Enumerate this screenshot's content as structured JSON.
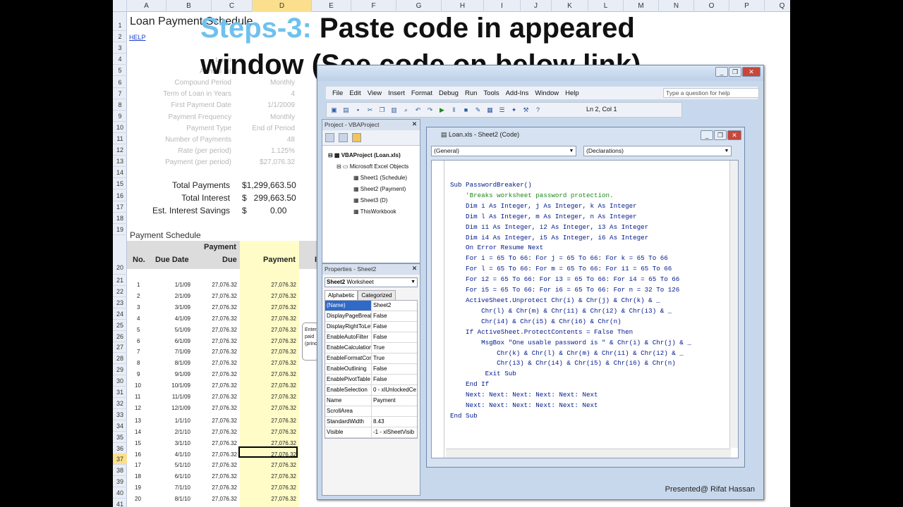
{
  "overlay": {
    "steps_label": "Steps-3:",
    "line1_rest": " Paste code in appeared",
    "line2": "window (See code on below link)."
  },
  "excel": {
    "columns": [
      "A",
      "B",
      "C",
      "D",
      "E",
      "F",
      "G",
      "H",
      "I",
      "J",
      "K",
      "L",
      "M",
      "N",
      "O",
      "P",
      "Q"
    ],
    "title": "Loan Payment Schedule",
    "help_link": "HELP",
    "ghost_labels": [
      "Loan",
      "Annual Int",
      "Compound Period",
      "Term of Loan in Years",
      "First Payment Date",
      "Payment Frequency",
      "Payment Type",
      "Number of Payments",
      "Rate (per period)",
      "Payment (per period)"
    ],
    "ghost_values": [
      "",
      "",
      "Monthly",
      "4",
      "1/1/2009",
      "Monthly",
      "End of Period",
      "48",
      "1.125%",
      "$27,076.32"
    ],
    "totals": [
      {
        "label": "Total Payments",
        "value": "$1,299,663.50"
      },
      {
        "label": "Total Interest",
        "value": "$   299,663.50"
      },
      {
        "label": "Est. Interest Savings",
        "value": "$          0.00"
      }
    ],
    "schedule_title": "Payment Schedule",
    "headers": {
      "payment_top": "Payment",
      "no": "No.",
      "due_date": "Due Date",
      "due": "Due",
      "payment": "Payment",
      "interest": "In"
    },
    "row_numbers": [
      "1",
      "2",
      "3",
      "4",
      "5",
      "6",
      "7",
      "8",
      "9",
      "10",
      "11",
      "12",
      "13",
      "14",
      "15",
      "16",
      "17",
      "18",
      "19",
      "20",
      "21",
      "22",
      "23",
      "24",
      "25",
      "26",
      "27",
      "28",
      "29",
      "30",
      "31",
      "32",
      "33",
      "34",
      "35",
      "36",
      "37",
      "38",
      "39",
      "40",
      "41"
    ],
    "rows": [
      {
        "no": "1",
        "date": "1/1/09",
        "due": "27,076.32",
        "pay": "27,076.32"
      },
      {
        "no": "2",
        "date": "2/1/09",
        "due": "27,076.32",
        "pay": "27,076.32"
      },
      {
        "no": "3",
        "date": "3/1/09",
        "due": "27,076.32",
        "pay": "27,076.32"
      },
      {
        "no": "4",
        "date": "4/1/09",
        "due": "27,076.32",
        "pay": "27,076.32"
      },
      {
        "no": "5",
        "date": "5/1/09",
        "due": "27,076.32",
        "pay": "27,076.32"
      },
      {
        "no": "6",
        "date": "6/1/09",
        "due": "27,076.32",
        "pay": "27,076.32"
      },
      {
        "no": "7",
        "date": "7/1/09",
        "due": "27,076.32",
        "pay": "27,076.32"
      },
      {
        "no": "8",
        "date": "8/1/09",
        "due": "27,076.32",
        "pay": "27,076.32"
      },
      {
        "no": "9",
        "date": "9/1/09",
        "due": "27,076.32",
        "pay": "27,076.32"
      },
      {
        "no": "10",
        "date": "10/1/09",
        "due": "27,076.32",
        "pay": "27,076.32"
      },
      {
        "no": "11",
        "date": "11/1/09",
        "due": "27,076.32",
        "pay": "27,076.32"
      },
      {
        "no": "12",
        "date": "12/1/09",
        "due": "27,076.32",
        "pay": "27,076.32"
      },
      {
        "no": "13",
        "date": "1/1/10",
        "due": "27,076.32",
        "pay": "27,076.32"
      },
      {
        "no": "14",
        "date": "2/1/10",
        "due": "27,076.32",
        "pay": "27,076.32"
      },
      {
        "no": "15",
        "date": "3/1/10",
        "due": "27,076.32",
        "pay": "27,076.32"
      },
      {
        "no": "16",
        "date": "4/1/10",
        "due": "27,076.32",
        "pay": "27,076.32"
      },
      {
        "no": "17",
        "date": "5/1/10",
        "due": "27,076.32",
        "pay": "27,076.32"
      },
      {
        "no": "18",
        "date": "6/1/10",
        "due": "27,076.32",
        "pay": "27,076.32"
      },
      {
        "no": "19",
        "date": "7/1/10",
        "due": "27,076.32",
        "pay": "27,076.32"
      },
      {
        "no": "20",
        "date": "8/1/10",
        "due": "27,076.32",
        "pay": "27,076.32"
      }
    ],
    "comment_fragments": [
      "Enter",
      "paid",
      "(princ"
    ]
  },
  "vbe": {
    "menu": [
      "File",
      "Edit",
      "View",
      "Insert",
      "Format",
      "Debug",
      "Run",
      "Tools",
      "Add-Ins",
      "Window",
      "Help"
    ],
    "help_placeholder": "Type a question for help",
    "cursor_pos": "Ln 2, Col 1",
    "project": {
      "title": "Project - VBAProject",
      "root": "VBAProject (Loan.xls)",
      "folder": "Microsoft Excel Objects",
      "items": [
        "Sheet1 (Schedule)",
        "Sheet2 (Payment)",
        "Sheet3 (D)",
        "ThisWorkbook"
      ]
    },
    "properties": {
      "title": "Properties - Sheet2",
      "object": "Sheet2",
      "object_type": "Worksheet",
      "tab_alpha": "Alphabetic",
      "tab_cat": "Categorized",
      "rows": [
        {
          "n": "(Name)",
          "v": "Sheet2"
        },
        {
          "n": "DisplayPageBreak",
          "v": "False"
        },
        {
          "n": "DisplayRightToLef",
          "v": "False"
        },
        {
          "n": "EnableAutoFilter",
          "v": "False"
        },
        {
          "n": "EnableCalculation",
          "v": "True"
        },
        {
          "n": "EnableFormatCon",
          "v": "True"
        },
        {
          "n": "EnableOutlining",
          "v": "False"
        },
        {
          "n": "EnablePivotTable",
          "v": "False"
        },
        {
          "n": "EnableSelection",
          "v": "0 - xlUnlockedCe"
        },
        {
          "n": "Name",
          "v": "Payment"
        },
        {
          "n": "ScrollArea",
          "v": ""
        },
        {
          "n": "StandardWidth",
          "v": "8.43"
        },
        {
          "n": "Visible",
          "v": "-1 - xlSheetVisib"
        }
      ]
    },
    "code_window": {
      "title": "Loan.xls - Sheet2 (Code)",
      "object_combo": "(General)",
      "proc_combo": "(Declarations)",
      "lines": [
        {
          "t": "Sub PasswordBreaker()",
          "c": ""
        },
        {
          "t": "    'Breaks worksheet password protection.",
          "c": "cm"
        },
        {
          "t": "    Dim i As Integer, j As Integer, k As Integer",
          "c": ""
        },
        {
          "t": "    Dim l As Integer, m As Integer, n As Integer",
          "c": ""
        },
        {
          "t": "    Dim i1 As Integer, i2 As Integer, i3 As Integer",
          "c": ""
        },
        {
          "t": "    Dim i4 As Integer, i5 As Integer, i6 As Integer",
          "c": ""
        },
        {
          "t": "    On Error Resume Next",
          "c": ""
        },
        {
          "t": "    For i = 65 To 66: For j = 65 To 66: For k = 65 To 66",
          "c": ""
        },
        {
          "t": "    For l = 65 To 66: For m = 65 To 66: For i1 = 65 To 66",
          "c": ""
        },
        {
          "t": "    For i2 = 65 To 66: For i3 = 65 To 66: For i4 = 65 To 66",
          "c": ""
        },
        {
          "t": "    For i5 = 65 To 66: For i6 = 65 To 66: For n = 32 To 126",
          "c": ""
        },
        {
          "t": "    ActiveSheet.Unprotect Chr(i) & Chr(j) & Chr(k) & _",
          "c": ""
        },
        {
          "t": "        Chr(l) & Chr(m) & Chr(i1) & Chr(i2) & Chr(i3) & _",
          "c": ""
        },
        {
          "t": "        Chr(i4) & Chr(i5) & Chr(i6) & Chr(n)",
          "c": ""
        },
        {
          "t": "    If ActiveSheet.ProtectContents = False Then",
          "c": ""
        },
        {
          "t": "        MsgBox \"One usable password is \" & Chr(i) & Chr(j) & _",
          "c": ""
        },
        {
          "t": "            Chr(k) & Chr(l) & Chr(m) & Chr(i1) & Chr(i2) & _",
          "c": ""
        },
        {
          "t": "            Chr(i3) & Chr(i4) & Chr(i5) & Chr(i6) & Chr(n)",
          "c": ""
        },
        {
          "t": "         Exit Sub",
          "c": ""
        },
        {
          "t": "    End If",
          "c": ""
        },
        {
          "t": "    Next: Next: Next: Next: Next: Next",
          "c": ""
        },
        {
          "t": "    Next: Next: Next: Next: Next: Next",
          "c": ""
        },
        {
          "t": "End Sub",
          "c": ""
        }
      ]
    },
    "credit": "Presented@ Rifat Hassan"
  }
}
